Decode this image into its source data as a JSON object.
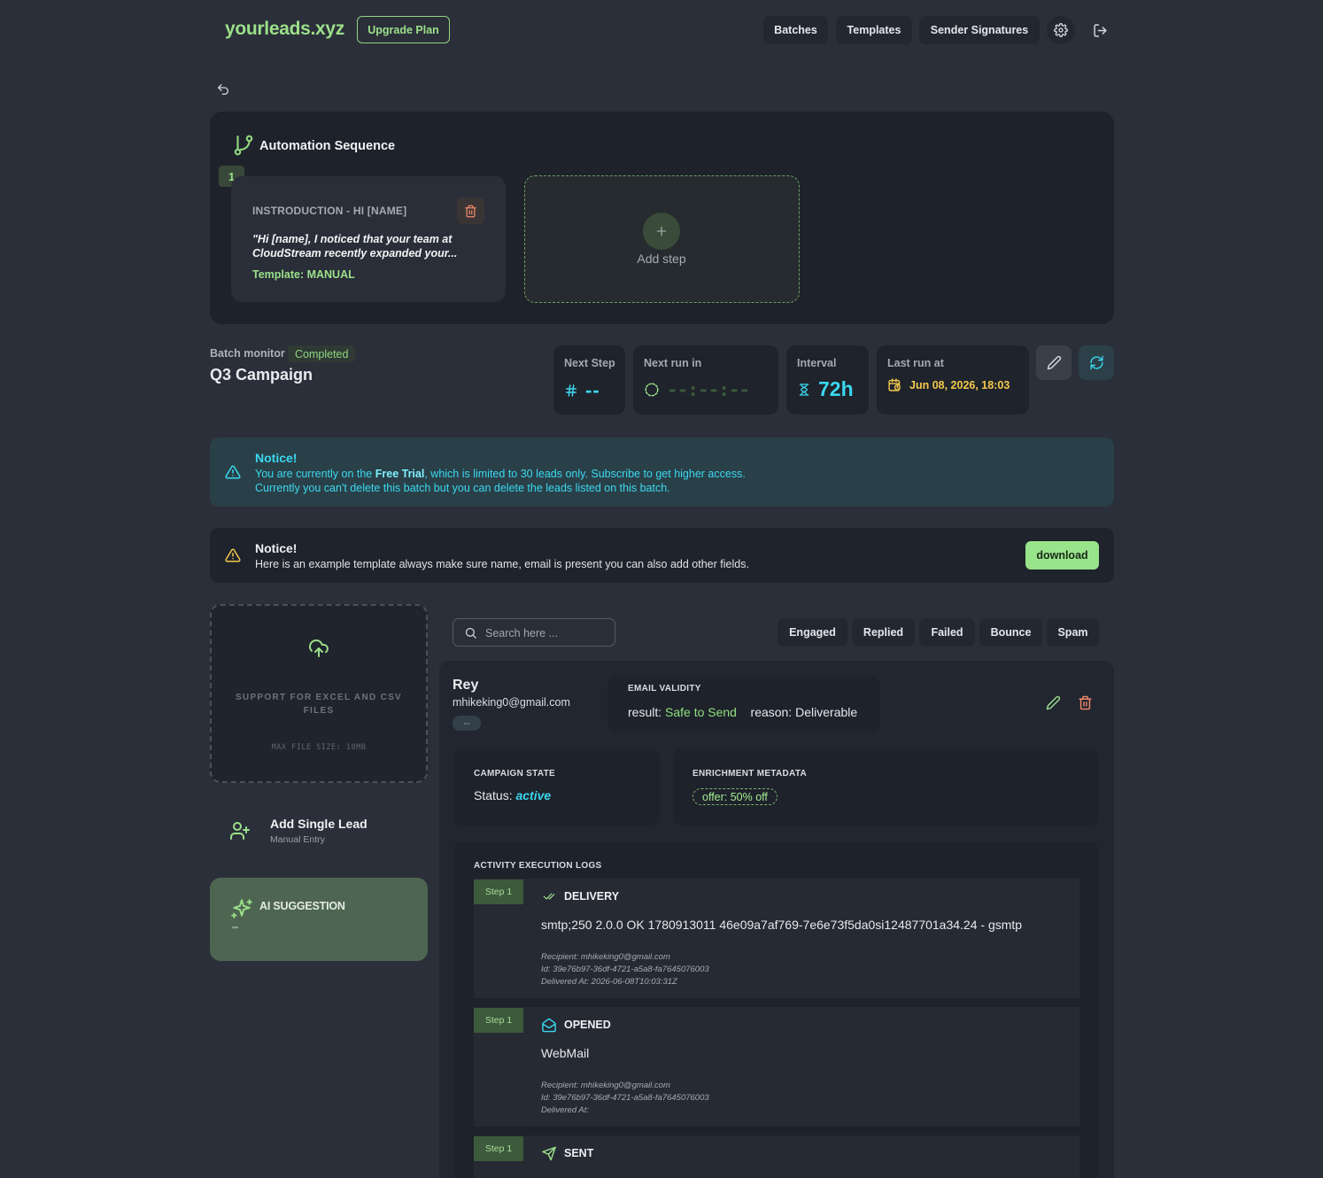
{
  "header": {
    "logo": "yourleads.xyz",
    "upgrade_label": "Upgrade Plan",
    "nav": [
      "Batches",
      "Templates",
      "Sender Signatures"
    ]
  },
  "automation": {
    "title": "Automation Sequence",
    "steps": [
      {
        "number": "1",
        "title": "INSTRODUCTION - HI [NAME]",
        "body_line1": "\"Hi [name], I noticed that your team at",
        "body_line2": "CloudStream recently expanded your...",
        "template": "Template: MANUAL"
      }
    ],
    "add_step_label": "Add step"
  },
  "batch": {
    "label": "Batch monitor",
    "status": "Completed",
    "name": "Q3 Campaign",
    "next_step": {
      "label": "Next Step",
      "value": "--"
    },
    "next_run": {
      "label": "Next run in",
      "value": "--:--:--"
    },
    "interval": {
      "label": "Interval",
      "value": "72h"
    },
    "last_run": {
      "label": "Last run at",
      "value": "Jun 08, 2026, 18:03"
    }
  },
  "notice_trial": {
    "title": "Notice!",
    "line1_pre": "You are currently on the ",
    "line1_bold": "Free Trial",
    "line1_post": ", which is limited to 30 leads only. Subscribe to get higher access.",
    "line2": "Currently you can't delete this batch but you can delete the leads listed on this batch."
  },
  "notice_template": {
    "title": "Notice!",
    "text": "Here is an example template always make sure name, email is present you can also add other fields.",
    "download_label": "download"
  },
  "upload": {
    "line1": "SUPPORT FOR EXCEL AND CSV",
    "line2": "FILES",
    "max_size": "MAX FILE SIZE: 10MB"
  },
  "single_lead": {
    "title": "Add Single Lead",
    "subtitle": "Manual Entry"
  },
  "ai": {
    "title": "AI SUGGESTION",
    "quote": "\"\""
  },
  "search": {
    "placeholder": "Search here ..."
  },
  "filters": [
    "Engaged",
    "Replied",
    "Failed",
    "Bounce",
    "Spam"
  ],
  "lead": {
    "name": "Rey",
    "email": "mhikeking0@gmail.com",
    "tag": "--",
    "validity": {
      "heading": "EMAIL VALIDITY",
      "result_label": "result:",
      "result_value": "Safe to Send",
      "reason_label": "reason:",
      "reason_value": "Deliverable"
    },
    "campaign": {
      "heading": "CAMPAIGN STATE",
      "status_label": "Status:",
      "status_value": "active"
    },
    "enrichment": {
      "heading": "ENRICHMENT METADATA",
      "chip": "offer: 50% off"
    },
    "logs_heading": "ACTIVITY EXECUTION LOGS",
    "logs": [
      {
        "step": "Step 1",
        "title": "DELIVERY",
        "detail": "smtp;250 2.0.0 OK 1780913011 46e09a7af769-7e6e73f5da0si12487701a34.24 - gsmtp",
        "recipient": "Recipient: mhikeking0@gmail.com",
        "id": "Id: 39e76b97-36df-4721-a5a8-fa7645076003",
        "delivered": "Delivered At: 2026-06-08T10:03:31Z"
      },
      {
        "step": "Step 1",
        "title": "OPENED",
        "detail": "WebMail",
        "recipient": "Recipient: mhikeking0@gmail.com",
        "id": "Id: 39e76b97-36df-4721-a5a8-fa7645076003",
        "delivered": "Delivered At:"
      },
      {
        "step": "Step 1",
        "title": "SENT"
      }
    ]
  },
  "colors": {
    "accent_green": "#9be08a",
    "accent_cyan": "#3ad8f0",
    "warning_yellow": "#f2c94c",
    "background": "#2b2f39"
  }
}
